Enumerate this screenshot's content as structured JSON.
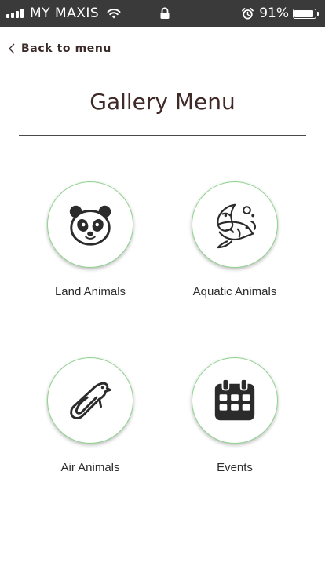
{
  "status_bar": {
    "carrier": "MY MAXIS",
    "battery_percent": "91%",
    "battery_level": 0.91,
    "icons": [
      "signal-icon",
      "wifi-icon",
      "lock-icon",
      "alarm-icon",
      "battery-icon"
    ]
  },
  "header": {
    "back_label": "Back to menu",
    "title": "Gallery Menu"
  },
  "menu": {
    "items": [
      {
        "label": "Land Animals",
        "icon": "panda-icon"
      },
      {
        "label": "Aquatic Animals",
        "icon": "fish-icon"
      },
      {
        "label": "Air Animals",
        "icon": "bird-icon"
      },
      {
        "label": "Events",
        "icon": "calendar-icon"
      }
    ]
  },
  "colors": {
    "status_bar_bg": "#3a3a3a",
    "title_text": "#3f2a27",
    "circle_border": "#8fd48f",
    "icon": "#2b2b2b"
  }
}
